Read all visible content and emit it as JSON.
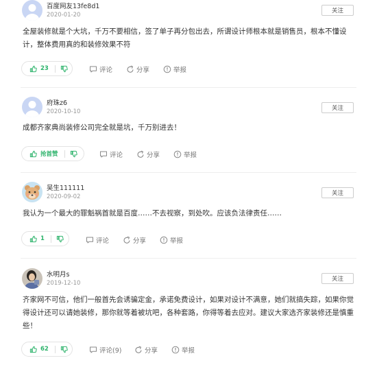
{
  "colors": {
    "accent": "#2db36b",
    "divider": "#eeeeee",
    "muted": "#999999",
    "text": "#333333"
  },
  "comments": [
    {
      "username": "百度网友13fe8d1",
      "date": "2020-01-20",
      "follow_label": "关注",
      "text": "全屋装修就是个大坑，千万不要相信，签了单子再分包出去，所谓设计师根本就是销售员，根本不懂设计，整体费用真的和装修效果不符",
      "vote_count": "23",
      "comment_label": "评论",
      "share_label": "分享",
      "report_label": "举报",
      "avatar_icon": "default-avatar-icon"
    },
    {
      "username": "府珠z6",
      "date": "2020-10-10",
      "follow_label": "关注",
      "text": "成都齐家典尚装修公司完全就是坑，千万别进去！",
      "vote_count": "抢首赞",
      "comment_label": "评论",
      "share_label": "分享",
      "report_label": "举报",
      "avatar_icon": "default-avatar-icon"
    },
    {
      "username": "吴生111111",
      "date": "2020-09-02",
      "follow_label": "关注",
      "text": "我认为一个最大的罪魁祸首就是百度……不去视察，到处吹。应该负法律责任……",
      "vote_count": "1",
      "comment_label": "评论",
      "share_label": "分享",
      "report_label": "举报",
      "avatar_icon": "cartoon-bear-avatar-icon"
    },
    {
      "username": "水明月s",
      "date": "2019-12-10",
      "follow_label": "关注",
      "text": "齐家网不可信，他们一般首先会诱骗定金，承诺免费设计，如果对设计不满意，她们就搞失踪，如果你觉得设计还可以请她装修，那你就等着被坑吧，各种套路，你得等着去应对。建议大家选齐家装修还是慎重些！",
      "vote_count": "62",
      "comment_label": "评论(9)",
      "share_label": "分享",
      "report_label": "举报",
      "avatar_icon": "photo-avatar-icon"
    }
  ]
}
